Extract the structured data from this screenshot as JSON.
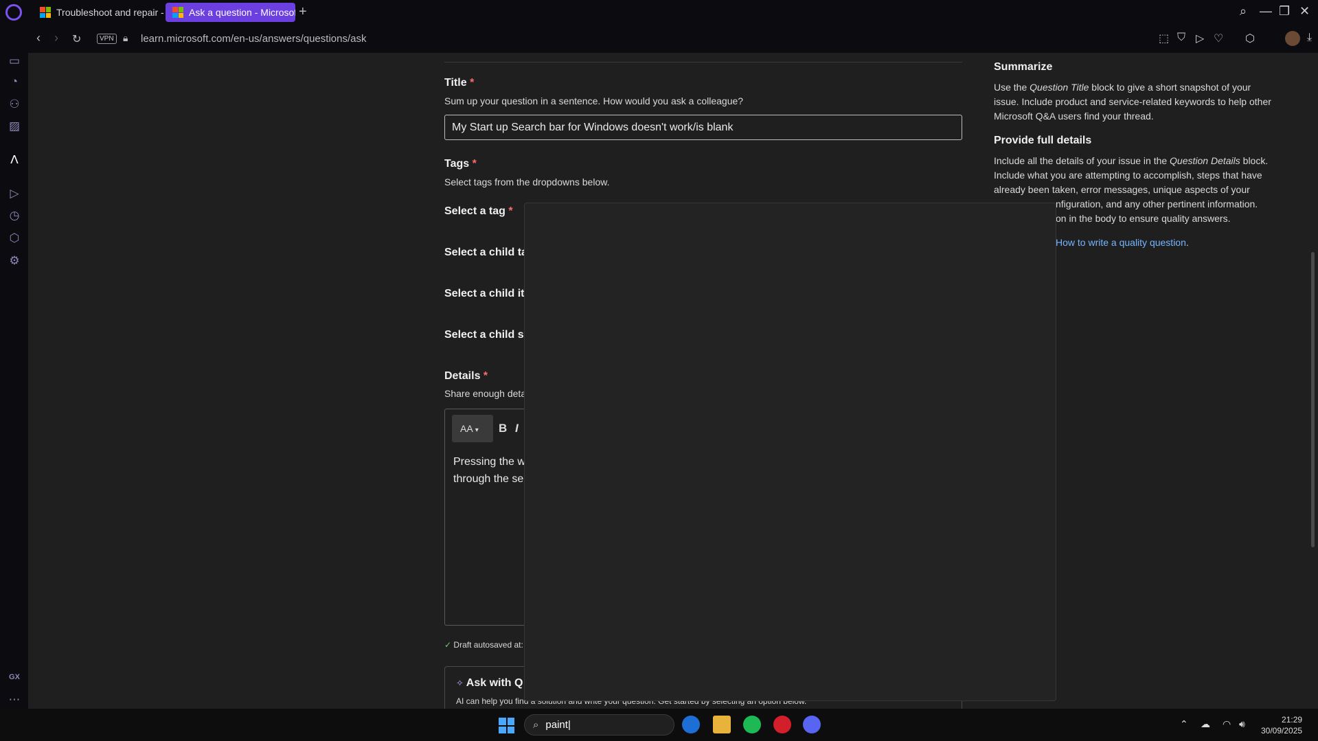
{
  "browser": {
    "tabs": [
      {
        "label": "Troubleshoot and repair -"
      },
      {
        "label": "Ask a question - Microsoft"
      }
    ],
    "new_tab_symbol": "+",
    "vpn_label": "VPN",
    "url": "learn.microsoft.com/en-us/answers/questions/ask"
  },
  "form": {
    "title_label": "Title",
    "title_help": "Sum up your question in a sentence. How would you ask a colleague?",
    "title_value": "My Start up Search bar for Windows doesn't work/is blank",
    "tags_label": "Tags",
    "tags_help": "Select tags from the dropdowns below.",
    "select_tag_label": "Select a tag",
    "select_child_tag_label": "Select a child tag",
    "select_child_item_label": "Select a child ite",
    "select_child_sub_label": "Select a child su",
    "details_label": "Details",
    "details_help": "Share enough deta",
    "required_mark": "*",
    "editor_aa": "AA",
    "editor_bold": "B",
    "editor_italic": "I",
    "editor_text_line1": "Pressing the w",
    "editor_text_line2": "through the se",
    "draft_status": "Draft autosaved at:",
    "ai_title": "Ask with Q",
    "ai_desc": "AI can help you find a solution and write your question. Get started by selecting an option below."
  },
  "side": {
    "summarize_h": "Summarize",
    "summarize_pre": "Use the ",
    "summarize_em": "Question Title",
    "summarize_post": " block to give a short snapshot of your issue. Include product and service-related keywords to help other Microsoft Q&A users find your thread.",
    "details_h": "Provide full details",
    "details_l1_pre": "Include all the details of your issue in the ",
    "details_l1_em": "Question Details",
    "details_l1_post": " block.",
    "details_l2": "Include what you are attempting to accomplish, steps that have",
    "details_l3": "already been taken, error messages, unique aspects of your",
    "details_l4": "nfiguration, and any other pertinent information.",
    "details_l5": "on in the body to ensure quality answers.",
    "link": "How to write a quality question",
    "link_suffix": "."
  },
  "taskbar": {
    "search_value": "paint",
    "time": "21:29",
    "date": "30/09/2025"
  },
  "colors": {
    "accent": "#6c3fe0",
    "page_bg": "#1f1f1f",
    "link": "#75b6ff",
    "required": "#ff6b6b"
  }
}
